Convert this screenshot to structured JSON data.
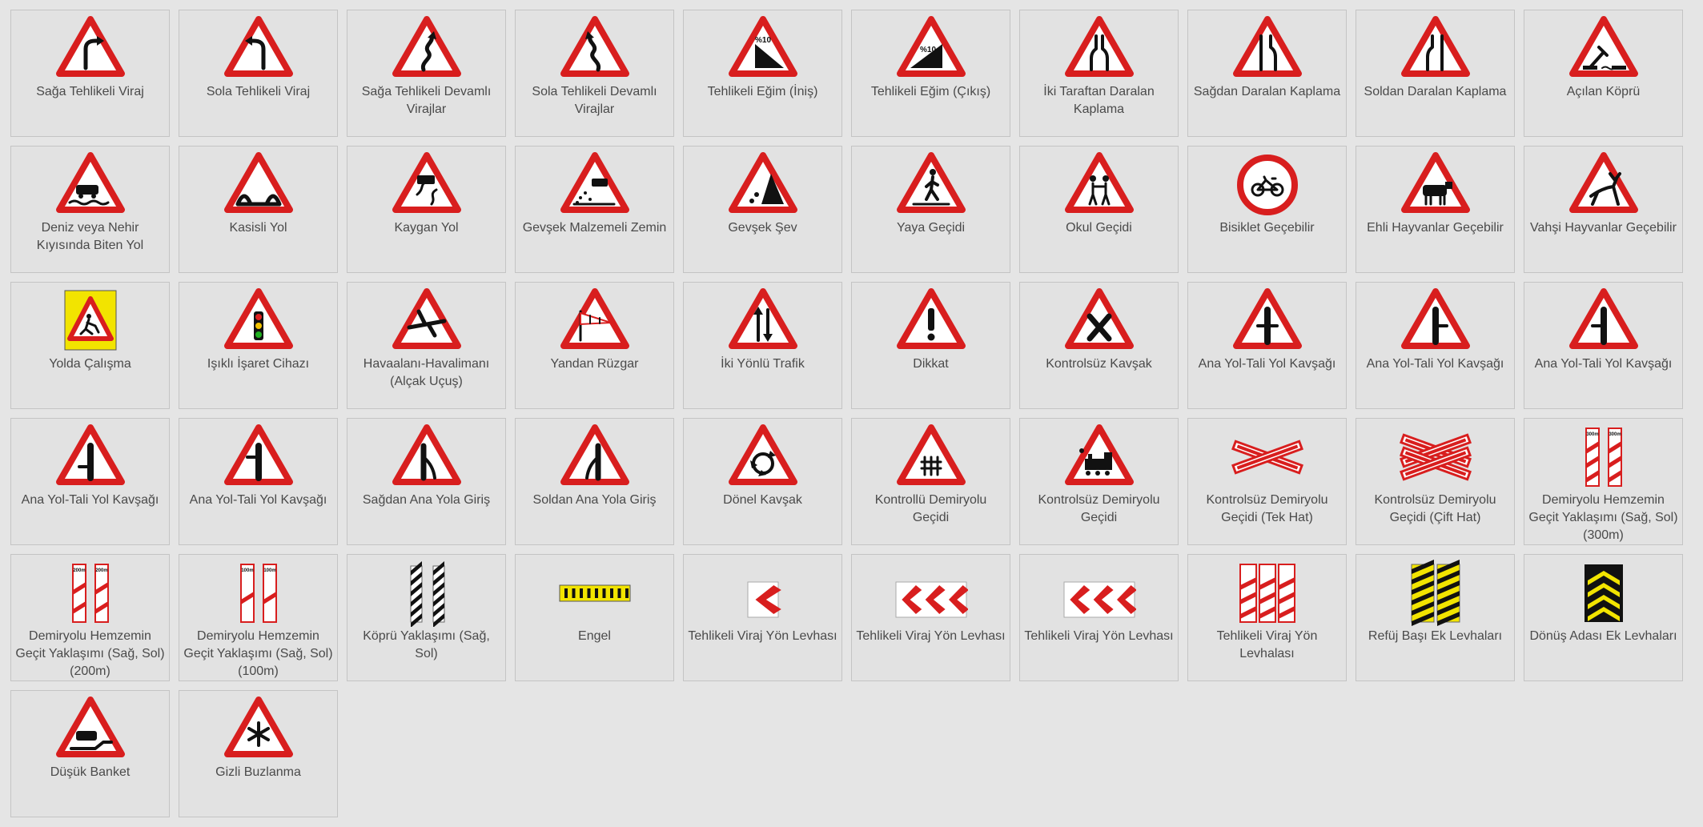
{
  "colors": {
    "sign_red": "#d81e1e",
    "background": "#e5e5e5",
    "card_border": "#c4c4c4",
    "label_text": "#4a4a4a"
  },
  "signs": [
    {
      "label": "Sağa Tehlikeli Viraj",
      "icon": "right-curve-icon"
    },
    {
      "label": "Sola Tehlikeli Viraj",
      "icon": "left-curve-icon"
    },
    {
      "label": "Sağa Tehlikeli Devamlı Virajlar",
      "icon": "double-curve-right-icon"
    },
    {
      "label": "Sola Tehlikeli Devamlı Virajlar",
      "icon": "double-curve-left-icon"
    },
    {
      "label": "Tehlikeli Eğim (İniş)",
      "icon": "descent-icon",
      "text": "%10"
    },
    {
      "label": "Tehlikeli Eğim (Çıkış)",
      "icon": "ascent-icon",
      "text": "%10"
    },
    {
      "label": "İki Taraftan Daralan Kaplama",
      "icon": "road-narrows-both-icon"
    },
    {
      "label": "Sağdan Daralan Kaplama",
      "icon": "road-narrows-right-icon"
    },
    {
      "label": "Soldan Daralan Kaplama",
      "icon": "road-narrows-left-icon"
    },
    {
      "label": "Açılan Köprü",
      "icon": "opening-bridge-icon"
    },
    {
      "label": "Deniz veya Nehir Kıyısında Biten Yol",
      "icon": "quay-icon"
    },
    {
      "label": "Kasisli Yol",
      "icon": "bumpy-road-icon"
    },
    {
      "label": "Kaygan Yol",
      "icon": "slippery-road-icon"
    },
    {
      "label": "Gevşek Malzemeli Zemin",
      "icon": "loose-gravel-icon"
    },
    {
      "label": "Gevşek Şev",
      "icon": "falling-rocks-icon"
    },
    {
      "label": "Yaya Geçidi",
      "icon": "pedestrian-crossing-icon"
    },
    {
      "label": "Okul Geçidi",
      "icon": "school-crossing-icon"
    },
    {
      "label": "Bisiklet Geçebilir",
      "icon": "bicycle-icon"
    },
    {
      "label": "Ehli Hayvanlar Geçebilir",
      "icon": "cattle-icon"
    },
    {
      "label": "Vahşi Hayvanlar Geçebilir",
      "icon": "deer-icon"
    },
    {
      "label": "Yolda Çalışma",
      "icon": "road-work-icon"
    },
    {
      "label": "Işıklı İşaret Cihazı",
      "icon": "traffic-light-icon"
    },
    {
      "label": "Havaalanı-Havalimanı (Alçak Uçuş)",
      "icon": "low-flying-aircraft-icon"
    },
    {
      "label": "Yandan Rüzgar",
      "icon": "crosswind-icon"
    },
    {
      "label": "İki Yönlü Trafik",
      "icon": "two-way-traffic-icon"
    },
    {
      "label": "Dikkat",
      "icon": "exclamation-icon"
    },
    {
      "label": "Kontrolsüz Kavşak",
      "icon": "uncontrolled-junction-icon"
    },
    {
      "label": "Ana Yol-Tali Yol Kavşağı",
      "icon": "crossroads-priority-icon"
    },
    {
      "label": "Ana Yol-Tali Yol Kavşağı",
      "icon": "side-road-right-icon"
    },
    {
      "label": "Ana Yol-Tali Yol Kavşağı",
      "icon": "side-road-left-icon"
    },
    {
      "label": "Ana Yol-Tali Yol Kavşağı",
      "icon": "side-road-left-lower-icon"
    },
    {
      "label": "Ana Yol-Tali Yol Kavşağı",
      "icon": "side-road-left-upper-icon"
    },
    {
      "label": "Sağdan Ana Yola Giriş",
      "icon": "merge-right-icon"
    },
    {
      "label": "Soldan Ana Yola Giriş",
      "icon": "merge-left-icon"
    },
    {
      "label": "Dönel Kavşak",
      "icon": "roundabout-icon"
    },
    {
      "label": "Kontrollü Demiryolu Geçidi",
      "icon": "railway-gate-icon"
    },
    {
      "label": "Kontrolsüz Demiryolu Geçidi",
      "icon": "train-icon"
    },
    {
      "label": "Kontrolsüz Demiryolu Geçidi (Tek Hat)",
      "icon": "single-cross-icon"
    },
    {
      "label": "Kontrolsüz Demiryolu Geçidi (Çift Hat)",
      "icon": "double-cross-icon"
    },
    {
      "label": "Demiryolu Hemzemin Geçit Yaklaşımı (Sağ, Sol) (300m)",
      "icon": "countdown-3-icon",
      "text": "300m"
    },
    {
      "label": "Demiryolu Hemzemin Geçit Yaklaşımı (Sağ, Sol) (200m)",
      "icon": "countdown-2-icon",
      "text": "200m"
    },
    {
      "label": "Demiryolu Hemzemin Geçit Yaklaşımı (Sağ, Sol) (100m)",
      "icon": "countdown-1-icon",
      "text": "100m"
    },
    {
      "label": "Köprü Yaklaşımı (Sağ, Sol)",
      "icon": "bridge-approach-icon"
    },
    {
      "label": "Engel",
      "icon": "obstacle-icon"
    },
    {
      "label": "Tehlikeli Viraj Yön Levhası",
      "icon": "chevron-single-icon"
    },
    {
      "label": "Tehlikeli Viraj Yön Levhası",
      "icon": "chevron-triple-icon"
    },
    {
      "label": "Tehlikeli Viraj Yön Levhası",
      "icon": "chevron-triple-alt-icon"
    },
    {
      "label": "Tehlikeli Viraj Yön Levhalası",
      "icon": "hazard-markers-icon"
    },
    {
      "label": "Refüj Başı Ek Levhaları",
      "icon": "refuge-markers-icon"
    },
    {
      "label": "Dönüş Adası Ek Levhaları",
      "icon": "island-marker-icon"
    },
    {
      "label": "Düşük Banket",
      "icon": "low-shoulder-icon"
    },
    {
      "label": "Gizli Buzlanma",
      "icon": "ice-icon"
    }
  ]
}
